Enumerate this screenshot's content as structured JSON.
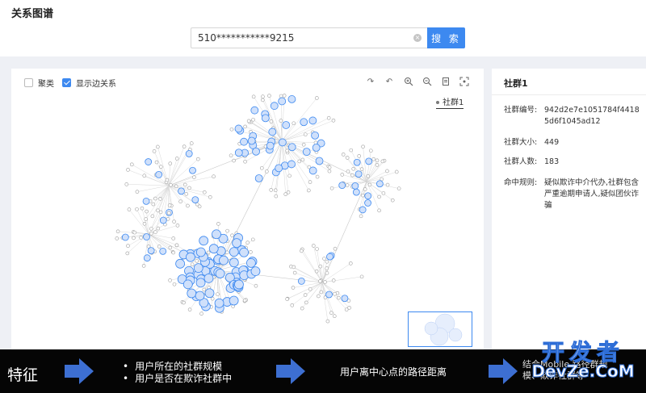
{
  "page": {
    "title": "关系图谱"
  },
  "search": {
    "value": "510***********9215",
    "button_label": "搜 索"
  },
  "graph": {
    "checkbox_cluster": {
      "label": "聚类",
      "checked": false
    },
    "checkbox_edges": {
      "label": "显示边关系",
      "checked": true
    },
    "toolbar": [
      "redo-icon",
      "undo-icon",
      "zoom-in-icon",
      "zoom-out-icon",
      "export-icon",
      "fit-view-icon"
    ],
    "legend": "社群1",
    "node_color": "#3d89f0",
    "minor_node_color": "#9e9e9e"
  },
  "detail": {
    "title": "社群1",
    "rows": [
      {
        "key": "社群编号:",
        "value": "942d2e7e1051784f44185d6f1045ad12"
      },
      {
        "key": "社群大小:",
        "value": "449"
      },
      {
        "key": "社群人数:",
        "value": "183"
      },
      {
        "key": "命中规则:",
        "value": "疑似欺诈中介代办,社群包含严重逾期申请人,疑似团伙诈骗"
      }
    ]
  },
  "banner": {
    "label": "特征",
    "bullets": [
      "用户所在的社群规模",
      "用户是否在欺诈社群中"
    ],
    "middle": "用户离中心点的路径距离",
    "right_lines": [
      "结合Mobile 路径群规",
      "模、欺诈社群等"
    ],
    "watermark_cn": "开发者",
    "watermark_en": "DevZe.CoM"
  }
}
